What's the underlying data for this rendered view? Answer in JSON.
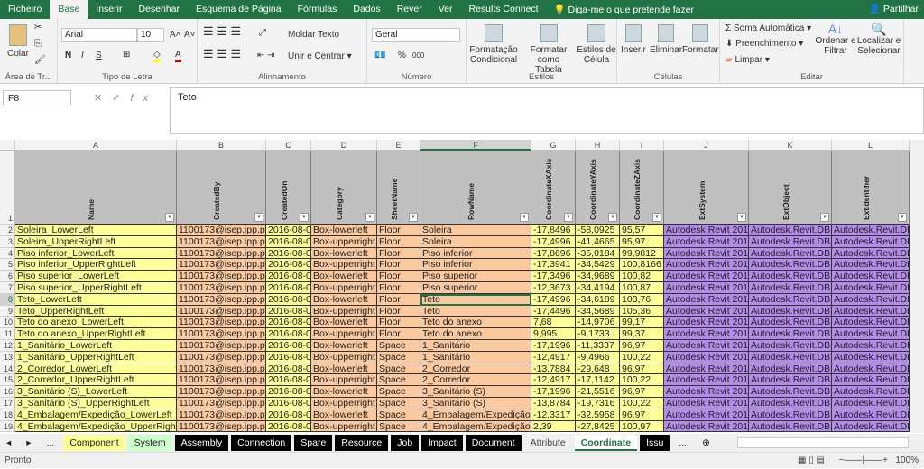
{
  "menu": {
    "tabs": [
      "Ficheiro",
      "Base",
      "Inserir",
      "Desenhar",
      "Esquema de Página",
      "Fórmulas",
      "Dados",
      "Rever",
      "Ver",
      "Results Connect"
    ],
    "active": "Base",
    "tell_me": "Diga-me o que pretende fazer",
    "share": "Partilhar"
  },
  "ribbon": {
    "clipboard": {
      "paste": "Colar",
      "label": "Área de Tr..."
    },
    "font": {
      "name": "Arial",
      "size": "10",
      "bold": "N",
      "italic": "I",
      "underline": "S",
      "label": "Tipo de Letra"
    },
    "alignment": {
      "wrap": "Moldar Texto",
      "merge": "Unir e Centrar",
      "label": "Alinhamento"
    },
    "number": {
      "format": "Geral",
      "percent": "%",
      "thousands": "000",
      "label": "Número"
    },
    "styles": {
      "conditional": [
        "Formatação",
        "Condicional"
      ],
      "table": [
        "Formatar como",
        "Tabela"
      ],
      "cell": [
        "Estilos de",
        "Célula"
      ],
      "label": "Estilos"
    },
    "cells": {
      "insert": "Inserir",
      "delete": "Eliminar",
      "format": "Formatar",
      "label": "Células"
    },
    "editing": {
      "autosum": "Soma Automática",
      "fill": "Preenchimento",
      "clear": "Limpar",
      "sort": [
        "Ordenar e",
        "Filtrar"
      ],
      "find": [
        "Localizar e",
        "Selecionar"
      ],
      "label": "Editar"
    }
  },
  "formula_bar": {
    "name_box": "F8",
    "value": "Teto"
  },
  "colors": {
    "yellow": "#ffff99",
    "peach": "#fac9a0",
    "purple": "#b38be8",
    "header": "#c0c0c0",
    "brand": "#217346"
  },
  "columns": [
    "A",
    "B",
    "C",
    "D",
    "E",
    "F",
    "G",
    "H",
    "I",
    "J",
    "K",
    "L"
  ],
  "headers": [
    "Name",
    "CreatedBy",
    "CreatedOn",
    "Category",
    "SheetName",
    "RowName",
    "CoordinateXAxis",
    "CoordinateYAxis",
    "CoordinateZAxis",
    "ExtSystem",
    "ExtObject",
    "ExtIdentifier"
  ],
  "rows": [
    [
      "Soleira_LowerLeft",
      "1100173@isep.ipp.pt",
      "2016-08-04",
      "Box-lowerleft",
      "Floor",
      "Soleira",
      "-17,8496",
      "-58,0925",
      "95,57",
      "Autodesk Revit 2016",
      "Autodesk.Revit.DB.X",
      "Autodesk.Revit.DB"
    ],
    [
      "Soleira_UpperRightLeft",
      "1100173@isep.ipp.pt",
      "2016-08-04",
      "Box-upperright",
      "Floor",
      "Soleira",
      "-17,4996",
      "-41,4665",
      "95,97",
      "Autodesk Revit 2016",
      "Autodesk.Revit.DB.X",
      "Autodesk.Revit.DB"
    ],
    [
      "Piso inferior_LowerLeft",
      "1100173@isep.ipp.pt",
      "2016-08-04",
      "Box-lowerleft",
      "Floor",
      "Piso inferior",
      "-17,8696",
      "-35,0184",
      "99,9812",
      "Autodesk Revit 2016",
      "Autodesk.Revit.DB.X",
      "Autodesk.Revit.DB"
    ],
    [
      "Piso inferior_UpperRightLeft",
      "1100173@isep.ipp.pt",
      "2016-08-04",
      "Box-upperright",
      "Floor",
      "Piso inferior",
      "-17,3941",
      "-34,5429",
      "100,8166",
      "Autodesk Revit 2016",
      "Autodesk.Revit.DB.X",
      "Autodesk.Revit.DB"
    ],
    [
      "Piso superior_LowerLeft",
      "1100173@isep.ipp.pt",
      "2016-08-04",
      "Box-lowerleft",
      "Floor",
      "Piso superior",
      "-17,3496",
      "-34,9689",
      "100,82",
      "Autodesk Revit 2016",
      "Autodesk.Revit.DB.X",
      "Autodesk.Revit.DB"
    ],
    [
      "Piso superior_UpperRightLeft",
      "1100173@isep.ipp.pt",
      "2016-08-04",
      "Box-upperright",
      "Floor",
      "Piso superior",
      "-12,3673",
      "-34,4194",
      "100,87",
      "Autodesk Revit 2016",
      "Autodesk.Revit.DB.X",
      "Autodesk.Revit.DB"
    ],
    [
      "Teto_LowerLeft",
      "1100173@isep.ipp.pt",
      "2016-08-04",
      "Box-lowerleft",
      "Floor",
      "Teto",
      "-17,4996",
      "-34,6189",
      "103,76",
      "Autodesk Revit 2016",
      "Autodesk.Revit.DB.X",
      "Autodesk.Revit.DB"
    ],
    [
      "Teto_UpperRightLeft",
      "1100173@isep.ipp.pt",
      "2016-08-04",
      "Box-upperright",
      "Floor",
      "Teto",
      "-17,4496",
      "-34,5689",
      "105,36",
      "Autodesk Revit 2016",
      "Autodesk.Revit.DB.X",
      "Autodesk.Revit.DB"
    ],
    [
      "Teto do anexo_LowerLeft",
      "1100173@isep.ipp.pt",
      "2016-08-04",
      "Box-lowerleft",
      "Floor",
      "Teto do anexo",
      "7,68",
      "-14,9706",
      "99,17",
      "Autodesk Revit 2016",
      "Autodesk.Revit.DB.X",
      "Autodesk.Revit.DB"
    ],
    [
      "Teto do anexo_UpperRightLeft",
      "1100173@isep.ipp.pt",
      "2016-08-04",
      "Box-upperright",
      "Floor",
      "Teto do anexo",
      "9,995",
      "-9,1733",
      "99,37",
      "Autodesk Revit 2016",
      "Autodesk.Revit.DB.X",
      "Autodesk.Revit.DB"
    ],
    [
      "1_Sanitário_LowerLeft",
      "1100173@isep.ipp.pt",
      "2016-08-04",
      "Box-lowerleft",
      "Space",
      "1_Sanitário",
      "-17,1996",
      "-11,3337",
      "96,97",
      "Autodesk Revit 2016",
      "Autodesk.Revit.DB.X",
      "Autodesk.Revit.DB"
    ],
    [
      "1_Sanitário_UpperRightLeft",
      "1100173@isep.ipp.pt",
      "2016-08-04",
      "Box-upperright",
      "Space",
      "1_Sanitário",
      "-12,4917",
      "-9,4966",
      "100,22",
      "Autodesk Revit 2016",
      "Autodesk.Revit.DB.X",
      "Autodesk.Revit.DB"
    ],
    [
      "2_Corredor_LowerLeft",
      "1100173@isep.ipp.pt",
      "2016-08-04",
      "Box-lowerleft",
      "Space",
      "2_Corredor",
      "-13,7884",
      "-29,648",
      "96,97",
      "Autodesk Revit 2016",
      "Autodesk.Revit.DB.X",
      "Autodesk.Revit.DB"
    ],
    [
      "2_Corredor_UpperRightLeft",
      "1100173@isep.ipp.pt",
      "2016-08-04",
      "Box-upperright",
      "Space",
      "2_Corredor",
      "-12,4917",
      "-17,1142",
      "100,22",
      "Autodesk Revit 2016",
      "Autodesk.Revit.DB.X",
      "Autodesk.Revit.DB"
    ],
    [
      "3_Sanitário (S)_LowerLeft",
      "1100173@isep.ipp.pt",
      "2016-08-04",
      "Box-lowerleft",
      "Space",
      "3_Sanitário (S)",
      "-17,1996",
      "-21,5516",
      "96,97",
      "Autodesk Revit 2016",
      "Autodesk.Revit.DB.X",
      "Autodesk.Revit.DB"
    ],
    [
      "3_Sanitário (S)_UpperRightLeft",
      "1100173@isep.ipp.pt",
      "2016-08-04",
      "Box-upperright",
      "Space",
      "3_Sanitário (S)",
      "-13,8784",
      "-19,7316",
      "100,22",
      "Autodesk Revit 2016",
      "Autodesk.Revit.DB.X",
      "Autodesk.Revit.DB"
    ],
    [
      "4_Embalagem/Expedição_LowerLeft",
      "1100173@isep.ipp.pt",
      "2016-08-04",
      "Box-lowerleft",
      "Space",
      "4_Embalagem/Expedição",
      "-12,3317",
      "-32,5958",
      "96,97",
      "Autodesk Revit 2016",
      "Autodesk.Revit.DB.X",
      "Autodesk.Revit.DB"
    ],
    [
      "4_Embalagem/Expedição_UpperRightLeft",
      "1100173@isep.ipp.pt",
      "2016-08-04",
      "Box-upperright",
      "Space",
      "4_Embalagem/Expedição",
      "2,39",
      "-27,8425",
      "100,97",
      "Autodesk Revit 2016",
      "Autodesk.Revit.DB.X",
      "Autodesk.Revit.DB"
    ]
  ],
  "sheet_tabs": [
    {
      "label": "Component",
      "bg": "#ffff99",
      "fg": "#222"
    },
    {
      "label": "System",
      "bg": "#ccffcc",
      "fg": "#222"
    },
    {
      "label": "Assembly",
      "bg": "#000000",
      "fg": "#fff"
    },
    {
      "label": "Connection",
      "bg": "#000000",
      "fg": "#fff"
    },
    {
      "label": "Spare",
      "bg": "#000000",
      "fg": "#fff"
    },
    {
      "label": "Resource",
      "bg": "#000000",
      "fg": "#fff"
    },
    {
      "label": "Job",
      "bg": "#000000",
      "fg": "#fff"
    },
    {
      "label": "Impact",
      "bg": "#000000",
      "fg": "#fff"
    },
    {
      "label": "Document",
      "bg": "#000000",
      "fg": "#fff"
    },
    {
      "label": "Attribute",
      "bg": "#f0f0f0",
      "fg": "#444"
    },
    {
      "label": "Coordinate",
      "bg": "#ffffff",
      "fg": "#217346",
      "active": true
    },
    {
      "label": "Issu",
      "bg": "#000000",
      "fg": "#fff"
    }
  ],
  "tab_nav": {
    "more": "..."
  },
  "status": {
    "text": "Pronto",
    "zoom": "100%"
  }
}
